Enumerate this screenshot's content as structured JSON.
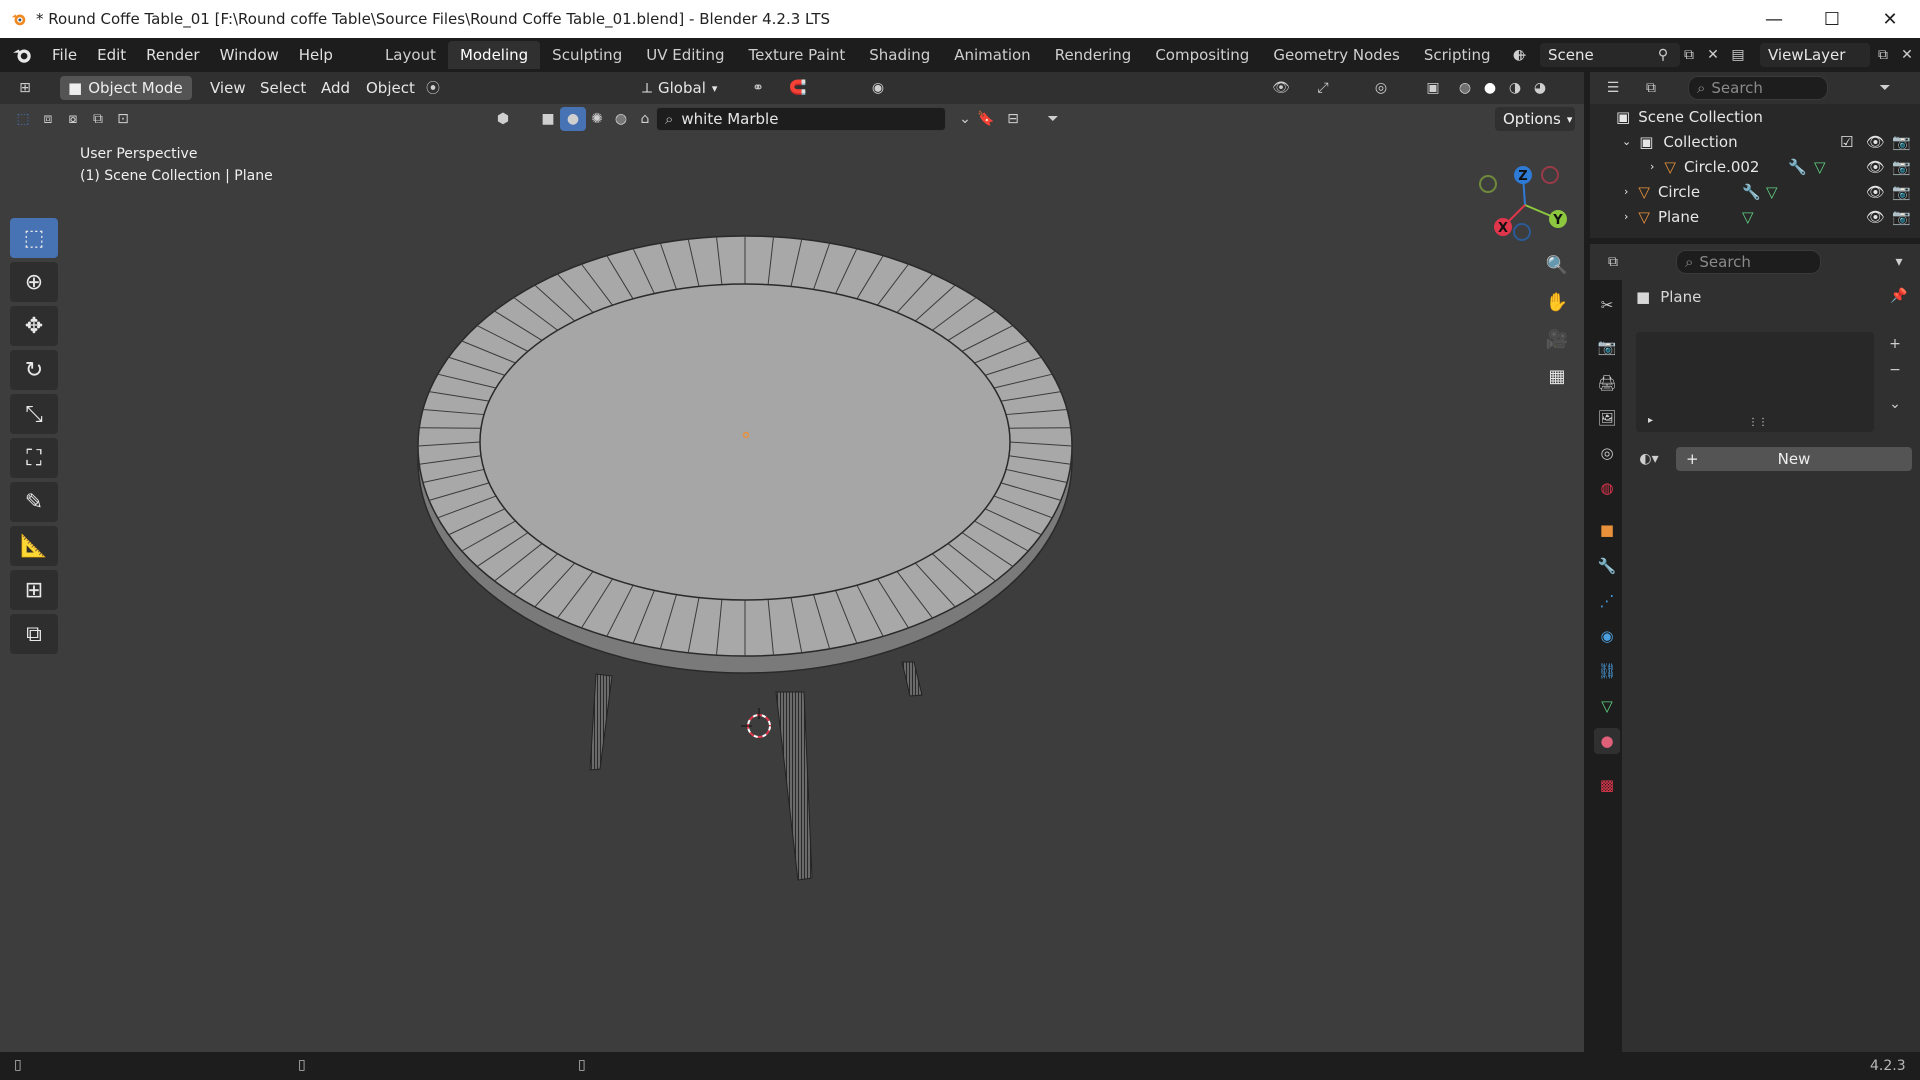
{
  "window": {
    "title": "* Round Coffe Table_01 [F:\\Round coffe Table\\Source Files\\Round Coffe Table_01.blend] - Blender 4.2.3 LTS",
    "minimize": "—",
    "maximize": "☐",
    "close": "✕"
  },
  "menu": [
    "File",
    "Edit",
    "Render",
    "Window",
    "Help"
  ],
  "workspaces": [
    "Layout",
    "Modeling",
    "Sculpting",
    "UV Editing",
    "Texture Paint",
    "Shading",
    "Animation",
    "Rendering",
    "Compositing",
    "Geometry Nodes",
    "Scripting"
  ],
  "active_workspace": "Modeling",
  "add_workspace": "+",
  "scene": {
    "name": "Scene",
    "view_layer": "ViewLayer"
  },
  "viewport": {
    "mode": "Object Mode",
    "menus": [
      "View",
      "Select",
      "Add",
      "Object"
    ],
    "transform_orientation": "Global",
    "material_search": "white Marble",
    "options_label": "Options",
    "perspective": "User Perspective",
    "context": "(1) Scene Collection | Plane"
  },
  "gizmo": {
    "x": "X",
    "y": "Y",
    "z": "Z"
  },
  "outliner": {
    "search_placeholder": "Search",
    "root": "Scene Collection",
    "collection": "Collection",
    "items": [
      "Circle.002",
      "Circle",
      "Plane"
    ]
  },
  "properties": {
    "search_placeholder": "Search",
    "object_name": "Plane",
    "new_label": "New"
  },
  "statusbar": {
    "version": "4.2.3"
  },
  "colors": {
    "accent": "#4772b3",
    "object_orange": "#e8903a",
    "mesh_green": "#5fcf80",
    "gizmo_x": "#e0364c",
    "gizmo_y": "#8dc63f",
    "gizmo_z": "#2e7bd6"
  }
}
